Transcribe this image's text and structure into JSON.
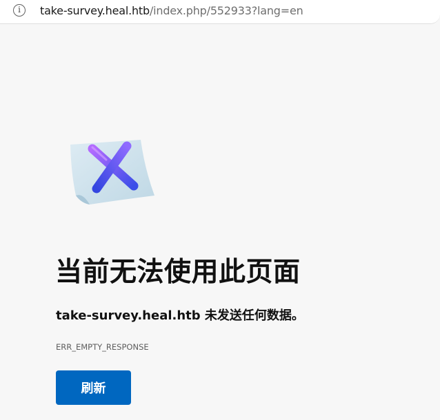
{
  "address_bar": {
    "url_host": "take-survey.heal.htb",
    "url_path": "/index.php/552933?lang=en",
    "info_icon": "info-icon"
  },
  "error_page": {
    "illustration_icon": "error-document-x-icon",
    "title": "当前无法使用此页面",
    "message": "take-survey.heal.htb 未发送任何数据。",
    "error_code": "ERR_EMPTY_RESPONSE",
    "refresh_label": "刷新"
  },
  "colors": {
    "page_background": "#f7f7f7",
    "button_background": "#0067c0",
    "x_gradient_start": "#b36bff",
    "x_gradient_end": "#3b4ee8"
  }
}
